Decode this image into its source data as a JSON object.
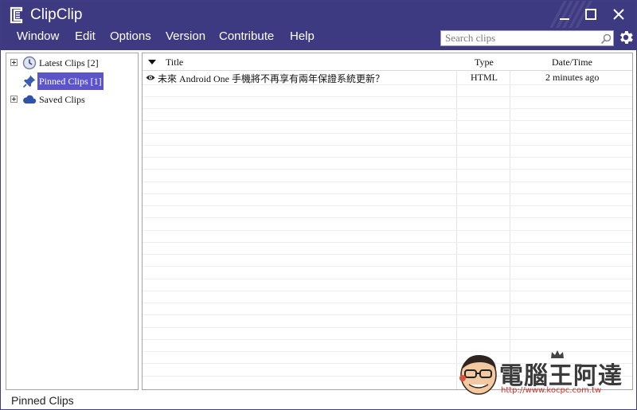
{
  "app": {
    "title": "ClipClip"
  },
  "menu": [
    "Window",
    "Edit",
    "Options",
    "Version",
    "Contribute",
    "Help"
  ],
  "search": {
    "placeholder": "Search clips"
  },
  "tree": [
    {
      "label": "Latest Clips [2]",
      "icon": "clock-icon",
      "selected": false
    },
    {
      "label": "Pinned Clips [1]",
      "icon": "pin-icon",
      "selected": true
    },
    {
      "label": "Saved Clips",
      "icon": "cloud-icon",
      "selected": false
    }
  ],
  "list": {
    "columns": [
      "Title",
      "Type",
      "Date/Time"
    ],
    "rows": [
      {
        "title": "未來 Android One 手機將不再享有兩年保證系統更新？",
        "type": "HTML",
        "datetime": "2 minutes ago"
      }
    ]
  },
  "status": {
    "text": "Pinned Clips"
  },
  "watermark": {
    "title": "電腦王阿達",
    "url": "http://www.kocpc.com.tw"
  },
  "colors": {
    "header": "#3e3a82",
    "selection": "#5b55c9",
    "text": "#111111"
  }
}
